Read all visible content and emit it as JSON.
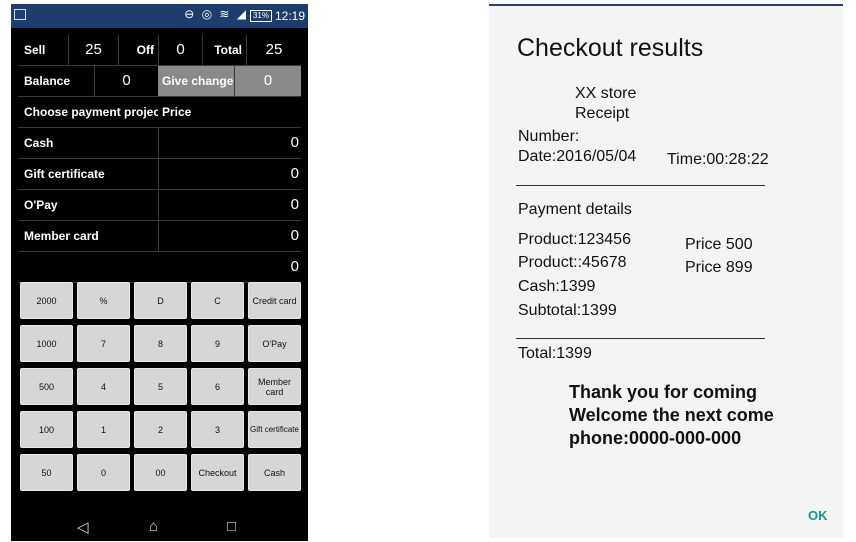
{
  "status_bar": {
    "icons": "⊖ ◎ ≋ ◢",
    "battery": "31%",
    "time": "12:19"
  },
  "pos": {
    "sell_label": "Sell",
    "sell_value": "25",
    "off_label": "Off",
    "off_value": "0",
    "total_label": "Total",
    "total_value": "25",
    "balance_label": "Balance",
    "balance_value": "0",
    "change_label": "Give change",
    "change_value": "0",
    "payment_header": "Choose payment project",
    "price_header": "Price",
    "payments": [
      {
        "label": "Cash",
        "value": "0"
      },
      {
        "label": "Gift certificate",
        "value": "0"
      },
      {
        "label": "O'Pay",
        "value": "0"
      },
      {
        "label": "Member card",
        "value": "0"
      },
      {
        "label": "",
        "value": "0"
      }
    ],
    "keys": [
      [
        "2000",
        "%",
        "D",
        "C",
        "Credit card"
      ],
      [
        "1000",
        "7",
        "8",
        "9",
        "O'Pay"
      ],
      [
        "500",
        "4",
        "5",
        "6",
        "Member card"
      ],
      [
        "100",
        "1",
        "2",
        "3",
        "Gift certificate"
      ],
      [
        "50",
        "0",
        "00",
        "Checkout",
        "Cash"
      ]
    ]
  },
  "nav": {
    "back": "◁",
    "home": "⌂",
    "recent": "□"
  },
  "dialog": {
    "title": "Checkout results",
    "store": "XX store",
    "receipt": "Receipt",
    "number": "Number:",
    "date": "Date:2016/05/04",
    "time": "Time:00:28:22",
    "details_title": "Payment details",
    "product1": "Product:123456",
    "price1": "Price 500",
    "product2": "Product::45678",
    "price2": "Price 899",
    "cash": "Cash:1399",
    "subtotal": "Subtotal:1399",
    "total": "Total:1399",
    "thanks1": "Thank you for coming",
    "thanks2": "Welcome the next come",
    "phone": "phone:0000-000-000",
    "ok": "OK"
  }
}
